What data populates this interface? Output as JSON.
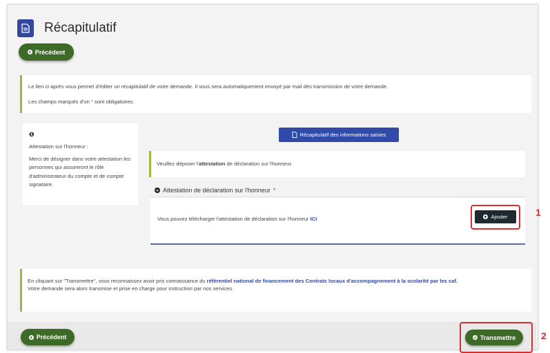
{
  "header": {
    "title": "Récapitulatif",
    "icon": "document-icon"
  },
  "buttons": {
    "previous_label": "Précédent",
    "recap_label": "Récapitulatif des informations saisies",
    "add_label": "Ajouter",
    "transmit_label": "Transmettre"
  },
  "info": {
    "line1": "Le lien ci-après vous permet d'éditer un récapitulatif de votre demande. Il vous sera automatiquement envoyé par mail dès transmission de votre demande.",
    "line2_pre": "Les champs marqués d'un ",
    "star": "*",
    "line2_post": " sont obligatoires."
  },
  "side_panel": {
    "icon": "info-icon",
    "title": "Attestation sur l'honneur :",
    "text": "Merci de désigner dans votre attestation les personnes qui assureront le rôle d'administrateur du compte et de compte signataire."
  },
  "deposit": {
    "pre": "Veuillez déposer l'",
    "bold": "attestation",
    "post": " de déclaration sur l'honneur."
  },
  "attestation_panel": {
    "title": "Attestation de déclaration sur l'honneur",
    "star": "*",
    "text_pre": "Vous pouvez télécharger l'attestation de déclaration sur l'honneur ",
    "link": "ICI"
  },
  "footer_info": {
    "pre": "En cliquant sur \"Transmettre\", vous reconnaissez avoir pris connaissance du ",
    "link": "référentiel national de financement des Contrats locaux d'accompagnement à la scolarité par les caf.",
    "line2": "Votre demande sera alors transmise et prise en charge pour instruction par nos services."
  },
  "annotations": {
    "one": "1",
    "two": "2"
  },
  "colors": {
    "accent_green": "#3e6a27",
    "primary_blue": "#2f4aa8",
    "annotation_red": "#d32f2f"
  }
}
